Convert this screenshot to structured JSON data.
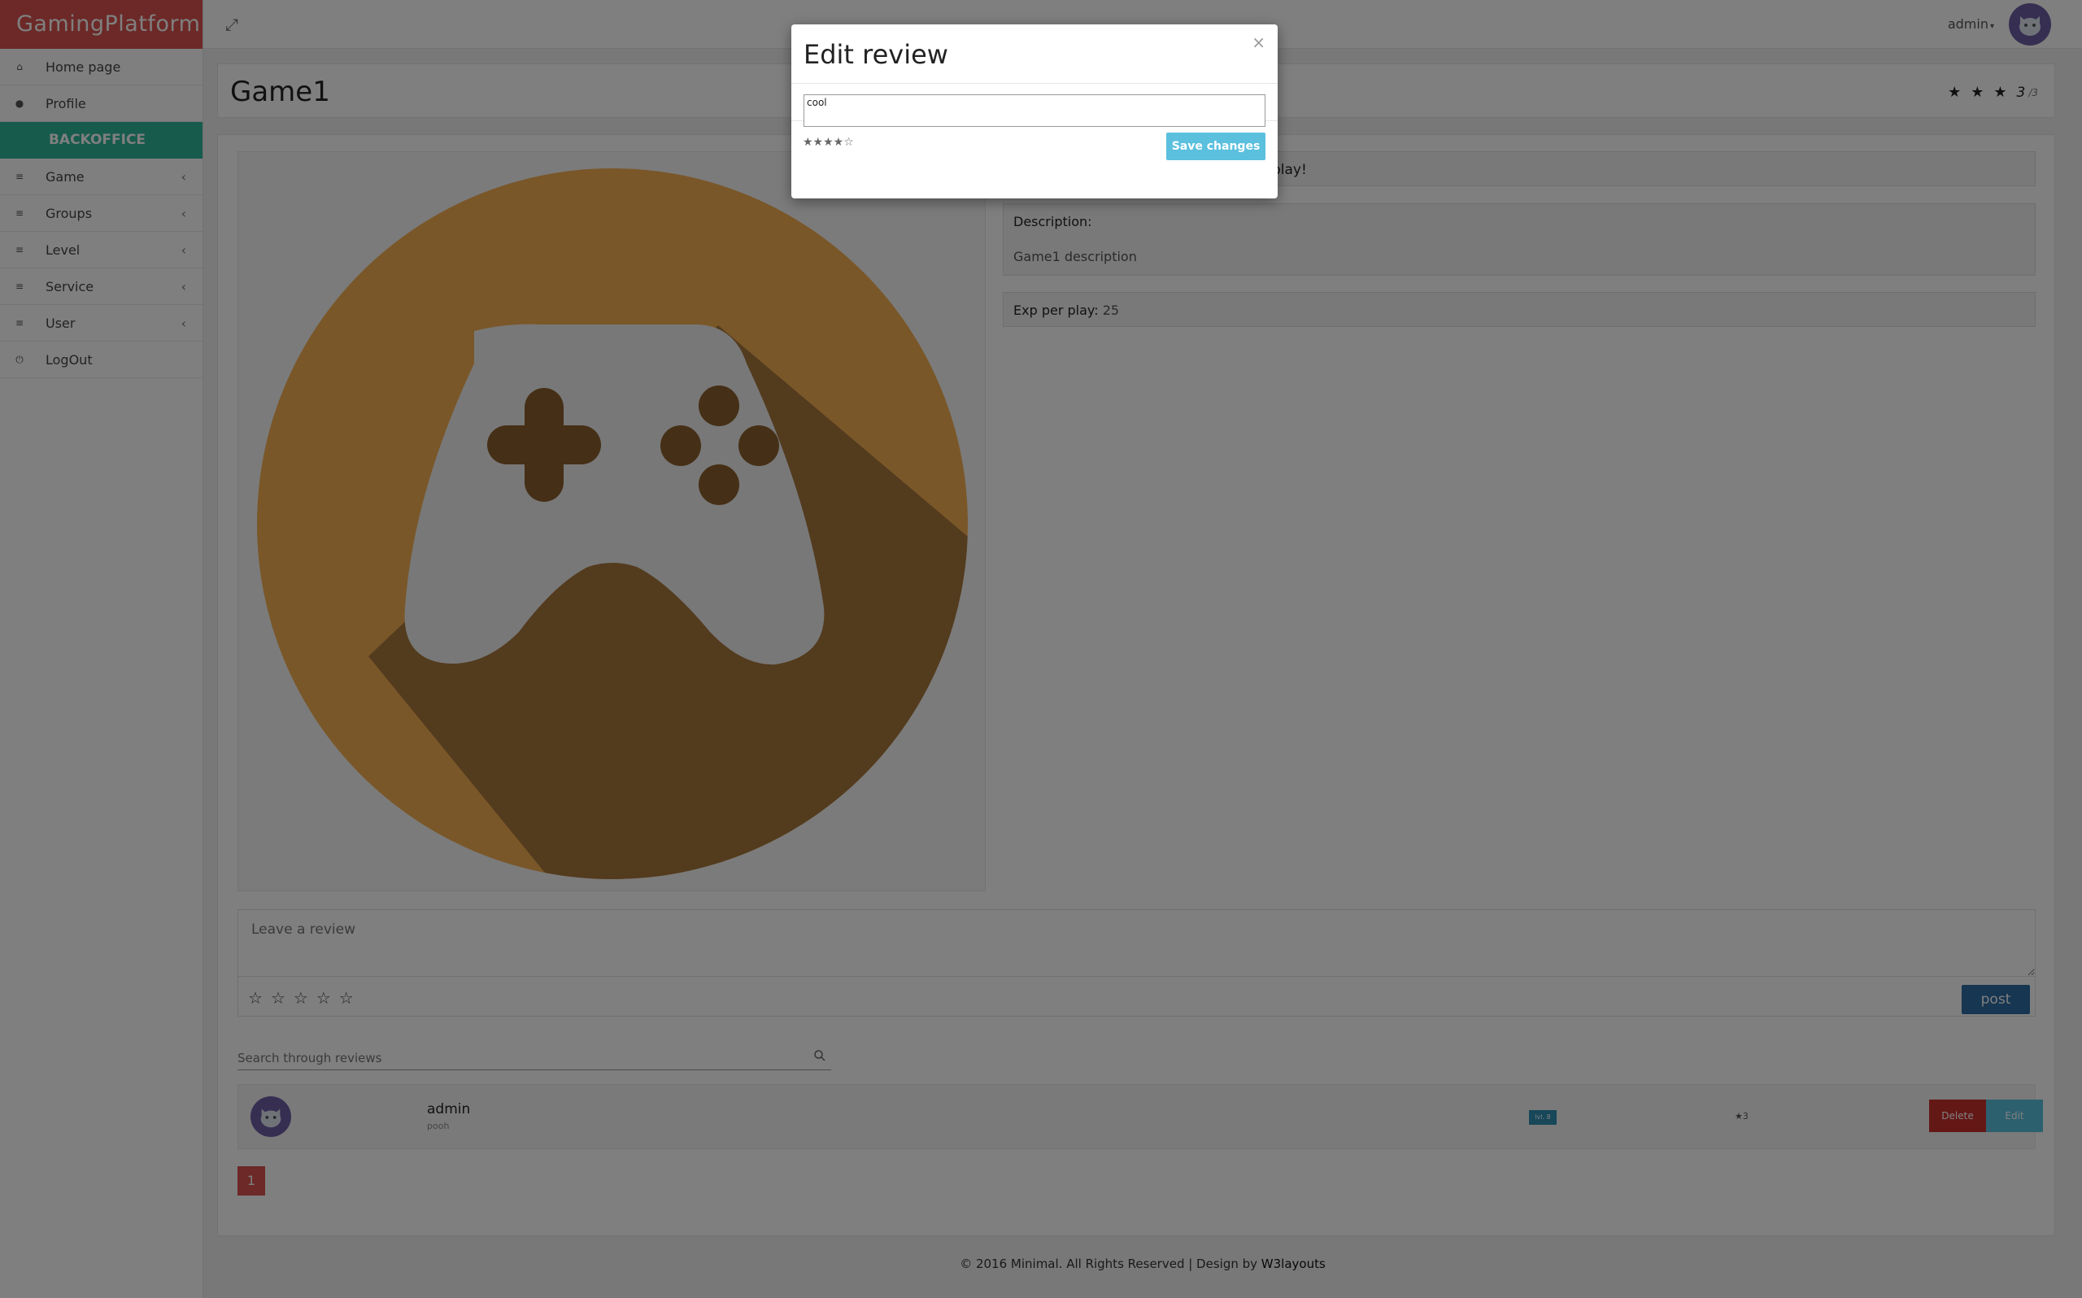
{
  "brand": "GamingPlatform",
  "sidebar": {
    "items": [
      {
        "label": "Home page",
        "icon": "home-icon"
      },
      {
        "label": "Profile",
        "icon": "user-icon"
      }
    ],
    "section": "BACKOFFICE",
    "admin_items": [
      {
        "label": "Game",
        "icon": "sliders-icon"
      },
      {
        "label": "Groups",
        "icon": "sliders-icon"
      },
      {
        "label": "Level",
        "icon": "sliders-icon"
      },
      {
        "label": "Service",
        "icon": "sliders-icon"
      },
      {
        "label": "User",
        "icon": "sliders-icon"
      }
    ],
    "logout": "LogOut"
  },
  "topbar": {
    "user": "admin"
  },
  "game": {
    "title": "Game1",
    "rating": "3",
    "rating_max": "/3",
    "info_title_visible": "play!",
    "description_label": "Description:",
    "description": "Game1 description",
    "exp_label": "Exp per play:",
    "exp_value": "25"
  },
  "review_form": {
    "placeholder": "Leave a review",
    "post_label": "post"
  },
  "search": {
    "placeholder": "Search through reviews"
  },
  "reviews": [
    {
      "user": "admin",
      "text": "pooh",
      "level": "lvl. 8",
      "stars": "★3",
      "delete_label": "Delete",
      "edit_label": "Edit"
    }
  ],
  "pagination": {
    "current": "1"
  },
  "footer": {
    "text": "© 2016 Minimal. All Rights Reserved | Design by ",
    "link": "W3layouts"
  },
  "modal": {
    "title": "Edit review",
    "close": "×",
    "text_value": "cool",
    "stars": "★★★★☆",
    "save_label": "Save changes"
  },
  "colors": {
    "brand_red": "#d9534f",
    "backoffice_green": "#2fb79a",
    "post_blue": "#2d6ca2",
    "info_cyan": "#5bc0de",
    "controller_orange": "#f4ae52"
  }
}
